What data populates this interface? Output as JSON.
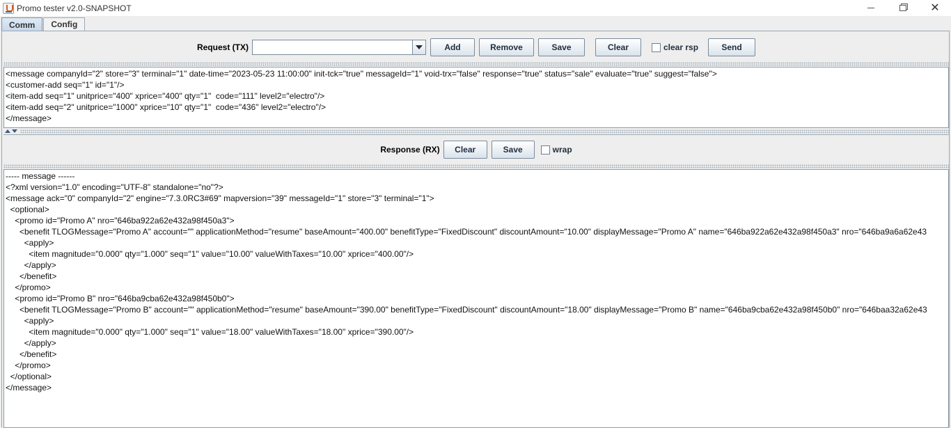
{
  "window": {
    "title": "Promo tester v2.0-SNAPSHOT"
  },
  "tabs": [
    {
      "label": "Comm",
      "active": true
    },
    {
      "label": "Config",
      "active": false
    }
  ],
  "request": {
    "label": "Request (TX)",
    "combo_value": "",
    "buttons": {
      "add": "Add",
      "remove": "Remove",
      "save": "Save",
      "clear": "Clear",
      "send": "Send"
    },
    "clear_rsp_label": "clear rsp",
    "clear_rsp_checked": false,
    "lines": [
      "<message companyId=\"2\" store=\"3\" terminal=\"1\" date-time=\"2023-05-23 11:00:00\" init-tck=\"true\" messageId=\"1\" void-trx=\"false\" response=\"true\" status=\"sale\" evaluate=\"true\" suggest=\"false\">",
      "<customer-add seq=\"1\" id=\"1\"/>",
      "<item-add seq=\"1\" unitprice=\"400\" xprice=\"400\" qty=\"1\"  code=\"111\" level2=\"electro\"/>",
      "<item-add seq=\"2\" unitprice=\"1000\" xprice=\"10\" qty=\"1\"  code=\"436\" level2=\"electro\"/>",
      "</message>"
    ]
  },
  "response": {
    "label": "Response (RX)",
    "buttons": {
      "clear": "Clear",
      "save": "Save"
    },
    "wrap_label": "wrap",
    "wrap_checked": false,
    "lines": [
      "----- message ------",
      "<?xml version=\"1.0\" encoding=\"UTF-8\" standalone=\"no\"?>",
      "<message ack=\"0\" companyId=\"2\" engine=\"7.3.0RC3#69\" mapversion=\"39\" messageId=\"1\" store=\"3\" terminal=\"1\">",
      "  <optional>",
      "    <promo id=\"Promo A\" nro=\"646ba922a62e432a98f450a3\">",
      "      <benefit TLOGMessage=\"Promo A\" account=\"\" applicationMethod=\"resume\" baseAmount=\"400.00\" benefitType=\"FixedDiscount\" discountAmount=\"10.00\" displayMessage=\"Promo A\" name=\"646ba922a62e432a98f450a3\" nro=\"646ba9a6a62e43",
      "        <apply>",
      "          <item magnitude=\"0.000\" qty=\"1.000\" seq=\"1\" value=\"10.00\" valueWithTaxes=\"10.00\" xprice=\"400.00\"/>",
      "        </apply>",
      "      </benefit>",
      "    </promo>",
      "    <promo id=\"Promo B\" nro=\"646ba9cba62e432a98f450b0\">",
      "      <benefit TLOGMessage=\"Promo B\" account=\"\" applicationMethod=\"resume\" baseAmount=\"390.00\" benefitType=\"FixedDiscount\" discountAmount=\"18.00\" displayMessage=\"Promo B\" name=\"646ba9cba62e432a98f450b0\" nro=\"646baa32a62e43",
      "        <apply>",
      "          <item magnitude=\"0.000\" qty=\"1.000\" seq=\"1\" value=\"18.00\" valueWithTaxes=\"18.00\" xprice=\"390.00\"/>",
      "        </apply>",
      "      </benefit>",
      "    </promo>",
      "  </optional>",
      "</message>"
    ]
  }
}
